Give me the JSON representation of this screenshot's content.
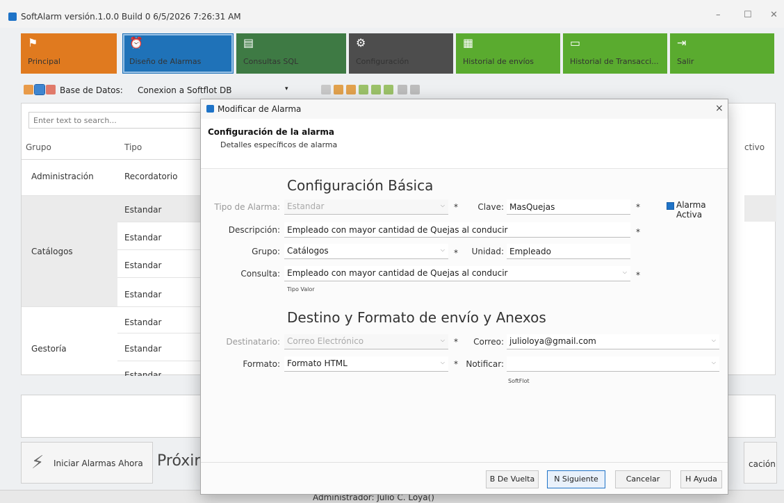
{
  "window": {
    "title": "SoftAlarm  versión.1.0.0 Build 0 6/5/2026 7:26:31 AM",
    "minimize": "–",
    "maximize": "☐",
    "close": "✕"
  },
  "ribbon": [
    {
      "label": "Principal",
      "icon": "flag-icon",
      "glyph": "⚑",
      "color": "#e07a1f"
    },
    {
      "label": "Diseño de Alarmas",
      "icon": "alarm-clock-icon",
      "glyph": "⏰",
      "color": "#1f72b8"
    },
    {
      "label": "Consultas SQL",
      "icon": "database-icon",
      "glyph": "▤",
      "color": "#3e7a44"
    },
    {
      "label": "Configuración",
      "icon": "gear-icon",
      "glyph": "⚙",
      "color": "#4d4d4d"
    },
    {
      "label": "Historial de envíos",
      "icon": "calendar-icon",
      "glyph": "▦",
      "color": "#5aab2f"
    },
    {
      "label": "Historial de Transacci...",
      "icon": "register-icon",
      "glyph": "▭",
      "color": "#5aab2f"
    },
    {
      "label": "Salir",
      "icon": "exit-icon",
      "glyph": "⇥",
      "color": "#5aab2f"
    }
  ],
  "toolbar": {
    "db_label": "Base de Datos:",
    "db_value": "Conexion a Softflot DB"
  },
  "grid": {
    "search_placeholder": "Enter text to search...",
    "col_grupo": "Grupo",
    "col_tipo": "Tipo",
    "col_activo": "ctivo",
    "groups": [
      "Administración",
      "Catálogos",
      "Gestoría"
    ],
    "tipos": [
      "Recordatorio",
      "Estandar",
      "Estandar",
      "Estandar",
      "Estandar",
      "Estandar",
      "Estandar",
      "Estandar"
    ]
  },
  "bottom": {
    "start_button": "Iniciar Alarmas Ahora",
    "proxima": "Próxir",
    "notif": "cación",
    "status": "Administrador: Julio C. Loya()"
  },
  "dialog": {
    "title": "Modificar de Alarma",
    "close": "×",
    "header_title": "Configuración de la alarma",
    "header_sub": "Detalles específicos de alarma",
    "section_basic": "Configuración Básica",
    "tipo_label": "Tipo de Alarma:",
    "tipo_value": "Estandar",
    "clave_label": "Clave:",
    "clave_value": "MasQuejas",
    "activa_label": "Alarma Activa",
    "desc_label": "Descripción:",
    "desc_value": "Empleado con mayor cantidad de Quejas al conducir",
    "grupo_label": "Grupo:",
    "grupo_value": "Catálogos",
    "unidad_label": "Unidad:",
    "unidad_value": "Empleado",
    "consulta_label": "Consulta:",
    "consulta_value": "Empleado con mayor cantidad de Quejas al conducir",
    "tipo_valor": "Tipo Valor",
    "section_dest": "Destino y Formato de envío y Anexos",
    "dest_label": "Destinatario:",
    "dest_value": "Correo Electrónico",
    "correo_label": "Correo:",
    "correo_value": "julioloya@gmail.com",
    "formato_label": "Formato:",
    "formato_value": "Formato HTML",
    "notificar_label": "Notificar:",
    "notificar_value": "",
    "softflot": "SoftFlot",
    "required": "*",
    "btn_back": "B De Vuelta",
    "btn_next": "N Siguiente",
    "btn_cancel": "Cancelar",
    "btn_help": "H Ayuda"
  }
}
